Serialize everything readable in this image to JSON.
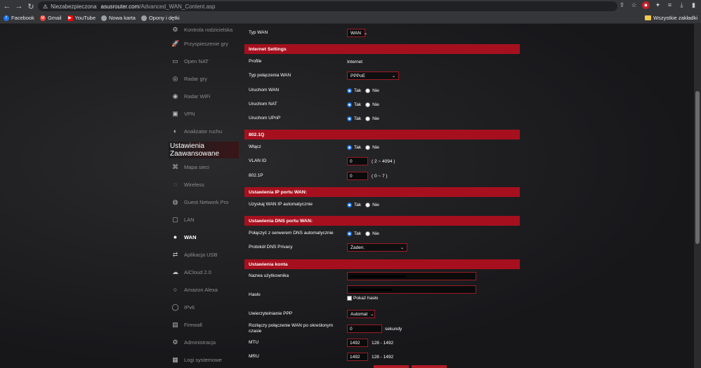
{
  "browser": {
    "security_label": "Niezabezpieczona",
    "url_host": "asusrouter.com",
    "url_path": "/Advanced_WAN_Content.asp",
    "bookmarks": [
      {
        "label": "Facebook",
        "color": "#1877f2",
        "icon": "facebook-icon"
      },
      {
        "label": "Gmail",
        "color": "#ea4335",
        "icon": "gmail-icon"
      },
      {
        "label": "YouTube",
        "color": "#ff0000",
        "icon": "youtube-icon"
      },
      {
        "label": "Nowa karta",
        "color": "#9aa0a6",
        "icon": "globe-icon"
      },
      {
        "label": "Opony i dętki",
        "color": "#9aa0a6",
        "icon": "globe-icon"
      }
    ],
    "all_bookmarks_label": "Wszystkie zakładki"
  },
  "sidebar": {
    "items_top": [
      {
        "label": "Kontrola rodzicielska",
        "icon": "parental-control-icon"
      },
      {
        "label": "Przyspieszenie gry",
        "icon": "game-boost-icon"
      },
      {
        "label": "Open NAT",
        "icon": "open-nat-icon"
      },
      {
        "label": "Radar gry",
        "icon": "game-radar-icon"
      },
      {
        "label": "Radar WiFi",
        "icon": "wifi-radar-icon"
      },
      {
        "label": "VPN",
        "icon": "vpn-icon"
      },
      {
        "label": "Analizator ruchu",
        "icon": "traffic-analyzer-icon"
      }
    ],
    "heading": "Ustawienia Zaawansowane",
    "items_advanced": [
      {
        "label": "Mapa sieci",
        "icon": "network-map-icon"
      },
      {
        "label": "Wireless",
        "icon": "wireless-icon"
      },
      {
        "label": "Guest Network Pro",
        "icon": "guest-network-icon"
      },
      {
        "label": "LAN",
        "icon": "lan-icon"
      },
      {
        "label": "WAN",
        "icon": "wan-icon",
        "active": true
      },
      {
        "label": "Aplikacja USB",
        "icon": "usb-icon"
      },
      {
        "label": "AiCloud 2.0",
        "icon": "cloud-icon"
      },
      {
        "label": "Amazon Alexa",
        "icon": "alexa-icon"
      },
      {
        "label": "IPv6",
        "icon": "ipv6-icon"
      },
      {
        "label": "Firewall",
        "icon": "firewall-icon"
      },
      {
        "label": "Administracja",
        "icon": "admin-icon"
      },
      {
        "label": "Logi systemowe",
        "icon": "system-log-icon"
      }
    ]
  },
  "main": {
    "wan_type_label": "Typ WAN",
    "wan_type_value": "WAN",
    "internet_settings": {
      "title": "Internet Settings",
      "profile_label": "Profile",
      "profile_value": "Internet",
      "conn_type_label": "Typ połączenia WAN",
      "conn_type_value": "PPPoE",
      "enable_wan_label": "Uruchom WAN",
      "enable_nat_label": "Uruchom NAT",
      "enable_upnp_label": "Uruchom UPnP"
    },
    "yes_label": "Tak",
    "no_label": "Nie",
    "dot1q": {
      "title": "802.1Q",
      "enable_label": "Włącz",
      "vlan_label": "VLAN ID",
      "vlan_value": "0",
      "vlan_range": "( 2 ~ 4094 )",
      "p_label": "802.1P",
      "p_value": "0",
      "p_range": "( 0 ~ 7 )"
    },
    "wan_ip": {
      "title": "Ustawienia IP portu WAN:",
      "auto_label": "Uzyskaj WAN IP automatycznie"
    },
    "wan_dns": {
      "title": "Ustawienia DNS portu WAN:",
      "auto_label": "Połączyć z serwerem DNS automatycznie",
      "privacy_label": "Protokół DNS Privacy",
      "privacy_value": "Żaden."
    },
    "account": {
      "title": "Ustawienia konta",
      "username_label": "Nazwa użytkownika",
      "password_label": "Hasło",
      "show_password_label": "Pokaż hasło",
      "auth_label": "Uwierzytelnianie PPP",
      "auth_value": "Automat",
      "idle_label": "Rozłączy połączenie WAN po określonym czasie",
      "idle_value": "0",
      "idle_unit": "sekundy",
      "mtu_label": "MTU",
      "mtu_value": "1492",
      "mtu_range": "128 - 1492",
      "mru_label": "MRU",
      "mru_value": "1492",
      "mru_range": "128 - 1492"
    }
  }
}
